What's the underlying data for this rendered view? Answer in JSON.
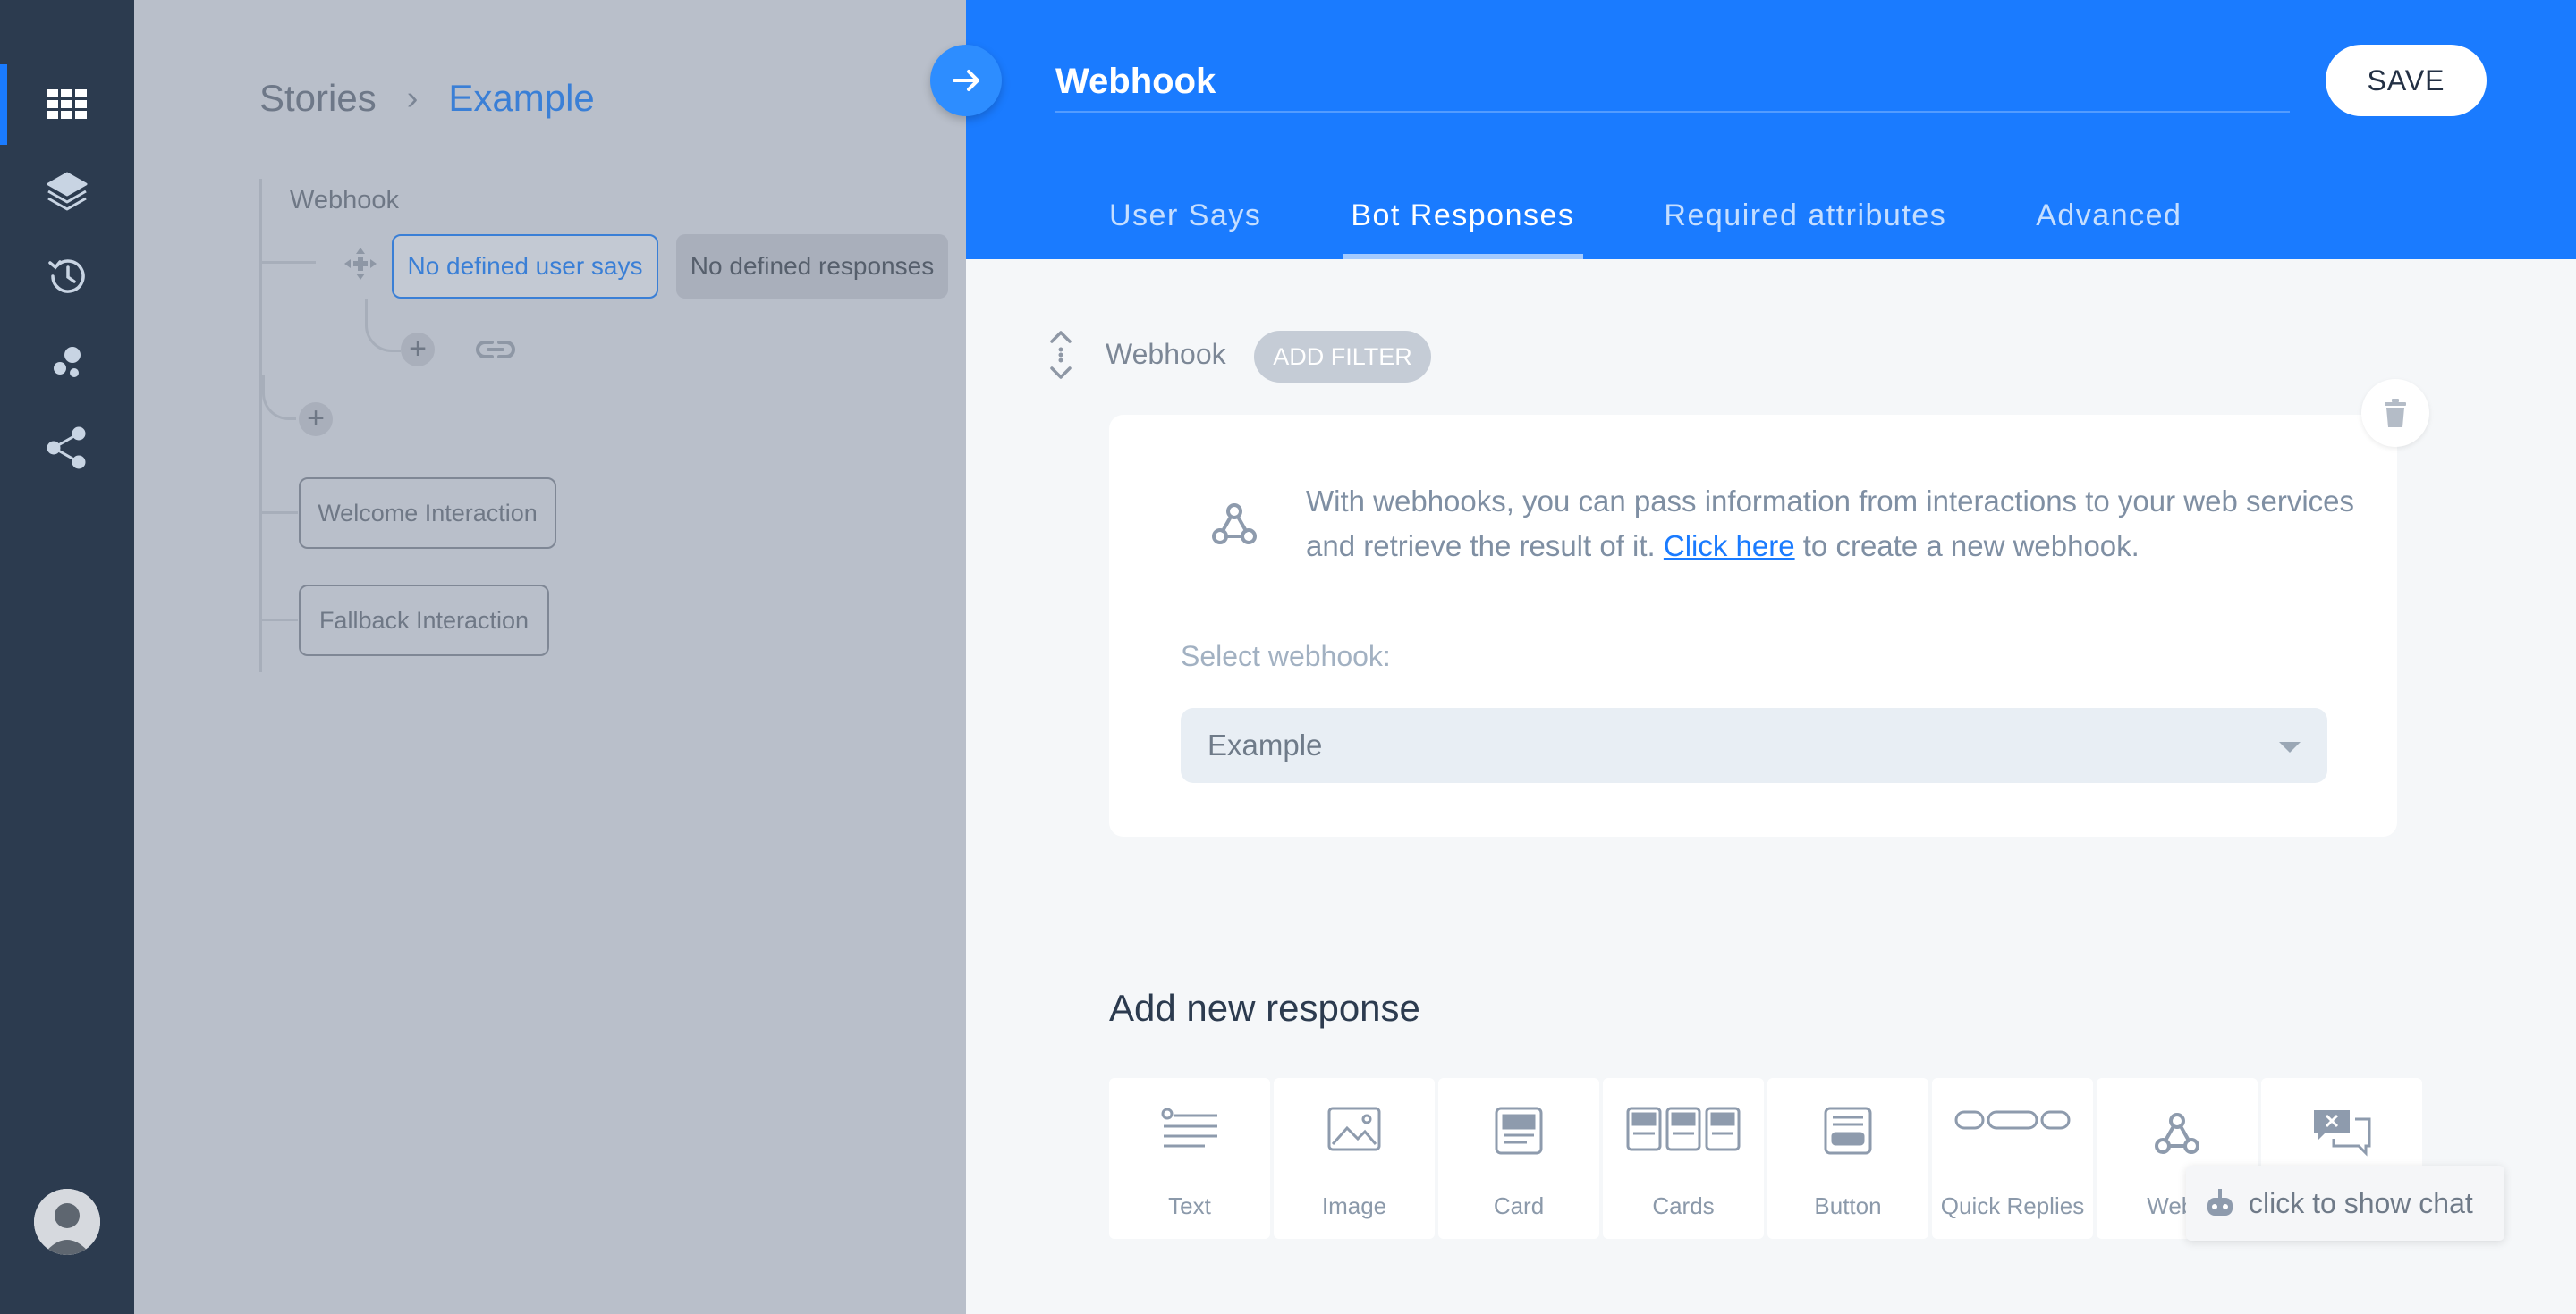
{
  "sidebar": {
    "items": [
      {
        "icon": "grid-icon",
        "active": true
      },
      {
        "icon": "layers-icon",
        "active": false
      },
      {
        "icon": "history-icon",
        "active": false
      },
      {
        "icon": "bubbles-icon",
        "active": false
      },
      {
        "icon": "share-icon",
        "active": false
      }
    ],
    "avatar": "user-avatar"
  },
  "canvas": {
    "breadcrumb": {
      "root": "Stories",
      "separator": "›",
      "current": "Example"
    },
    "node_title": "Webhook",
    "user_says_pill": "No defined user says",
    "responses_pill": "No defined responses",
    "add_symbol": "+",
    "welcome_node": "Welcome Interaction",
    "fallback_node": "Fallback Interaction"
  },
  "panel": {
    "title_value": "Webhook",
    "save_label": "SAVE",
    "tabs": [
      {
        "label": "User Says",
        "active": false
      },
      {
        "label": "Bot Responses",
        "active": true
      },
      {
        "label": "Required attributes",
        "active": false
      },
      {
        "label": "Advanced",
        "active": false
      }
    ],
    "response": {
      "type_label": "Webhook",
      "filter_button": "ADD FILTER",
      "info_before_link": "With webhooks, you can pass information from interactions to your web services and retrieve the result of it. ",
      "info_link": "Click here",
      "info_after_link": " to create a new webhook.",
      "select_label": "Select webhook:",
      "select_value": "Example"
    },
    "add_new": {
      "title": "Add new response",
      "types": [
        {
          "label": "Text",
          "icon": "text-icon"
        },
        {
          "label": "Image",
          "icon": "image-icon"
        },
        {
          "label": "Card",
          "icon": "card-icon"
        },
        {
          "label": "Cards",
          "icon": "cards-icon"
        },
        {
          "label": "Button",
          "icon": "button-icon"
        },
        {
          "label": "Quick Replies",
          "icon": "quick-replies-icon"
        },
        {
          "label": "Webh",
          "icon": "webhook-icon"
        },
        {
          "label": "",
          "icon": "chat-close-icon"
        }
      ]
    },
    "chat_toast": "click to show chat"
  },
  "colors": {
    "accent": "#1a7bff",
    "sidebar": "#2c3b4f",
    "overlay": "#b9bfca",
    "link": "#3a7fd6"
  }
}
